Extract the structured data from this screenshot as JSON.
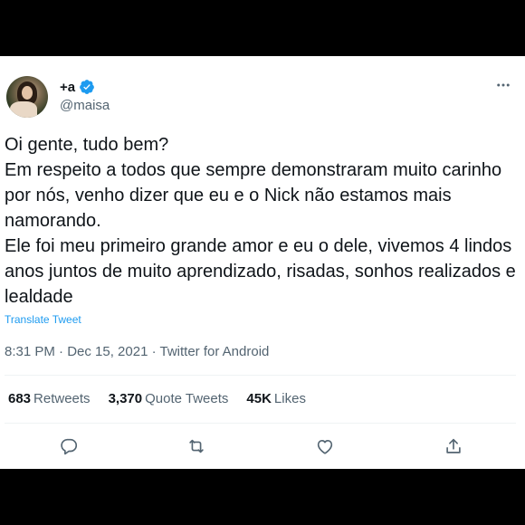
{
  "tweet": {
    "author": {
      "display_name": "+a",
      "handle": "@maisa",
      "verified": true
    },
    "text": "Oi gente, tudo bem?\nEm respeito a todos que sempre demonstraram muito carinho por nós, venho dizer que eu e o Nick não estamos mais namorando.\nEle foi meu primeiro grande amor e eu o dele, vivemos 4 lindos anos juntos de muito aprendizado, risadas, sonhos realizados e lealdade",
    "translate_label": "Translate Tweet",
    "timestamp": "8:31 PM · Dec 15, 2021 · Twitter for Android",
    "stats": {
      "retweets_count": "683",
      "retweets_label": "Retweets",
      "quotes_count": "3,370",
      "quotes_label": "Quote Tweets",
      "likes_count": "45K",
      "likes_label": "Likes"
    }
  },
  "icons": [
    "verified-badge-icon",
    "more-options-icon",
    "reply-icon",
    "retweet-icon",
    "like-icon",
    "share-icon"
  ],
  "colors": {
    "accent": "#1d9bf0",
    "text_primary": "#0f1419",
    "text_secondary": "#536471",
    "divider": "#eff3f4",
    "frame": "#000000"
  }
}
